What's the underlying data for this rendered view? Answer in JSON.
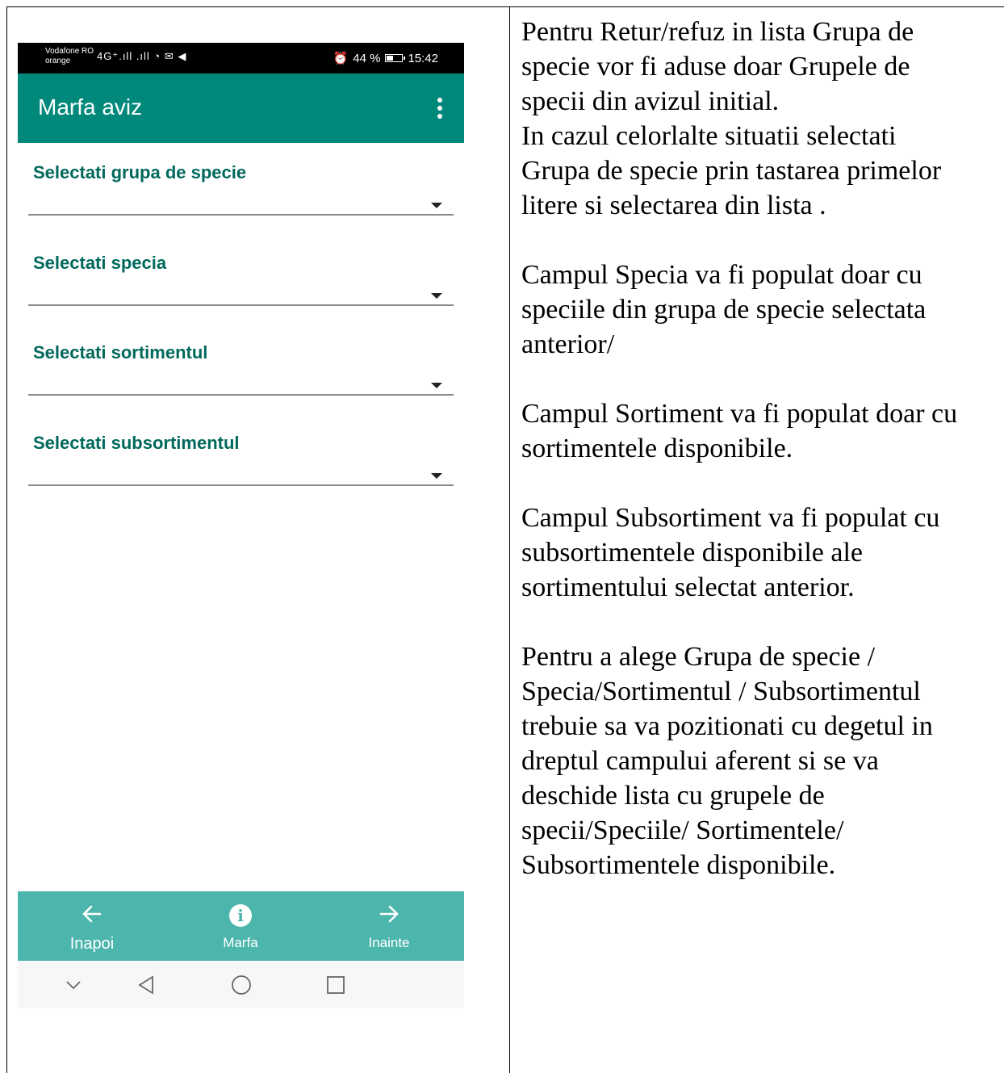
{
  "status_bar": {
    "carrier_line1": "Vodafone RO",
    "carrier_line2": "orange",
    "network_icons": "4G⁺.ıll .ıll ◔ ✉ ◀",
    "battery_text": "44 %",
    "battery_level_percent": 44,
    "time": "15:42"
  },
  "app_bar": {
    "title": "Marfa aviz",
    "menu_icon": "more-vert-icon"
  },
  "fields": [
    {
      "label": "Selectati grupa de specie"
    },
    {
      "label": "Selectati specia"
    },
    {
      "label": "Selectati sortimentul"
    },
    {
      "label": "Selectati subsortimentul"
    }
  ],
  "bottom_nav": {
    "back": {
      "label": "Inapoi",
      "icon": "arrow-left-icon"
    },
    "info": {
      "label": "Marfa",
      "icon": "info-icon"
    },
    "next": {
      "label": "Inainte",
      "icon": "arrow-right-icon"
    }
  },
  "system_nav": [
    "chevron-down-icon",
    "back-triangle-icon",
    "home-circle-icon",
    "recents-square-icon"
  ],
  "instructions": [
    {
      "lines": [
        "Pentru Retur/refuz in lista Grupa de",
        "specie vor fi aduse doar Grupele de",
        "specii din avizul initial.",
        "In cazul celorlalte situatii selectati",
        "Grupa de specie prin tastarea primelor",
        "litere si selectarea din lista ."
      ]
    },
    {
      "lines": [
        "Campul Specia va fi populat doar cu",
        "speciile din grupa de specie selectata",
        "anterior/"
      ]
    },
    {
      "lines": [
        "Campul Sortiment va fi populat doar cu",
        "sortimentele disponibile."
      ]
    },
    {
      "lines": [
        "Campul Subsortiment va fi populat cu",
        "subsortimentele disponibile ale",
        "sortimentului selectat anterior."
      ]
    },
    {
      "lines": [
        "Pentru a alege Grupa de specie /",
        "Specia/Sortimentul / Subsortimentul",
        "trebuie sa va pozitionati  cu degetul in",
        "dreptul campului aferent si se va",
        "deschide lista cu grupele de",
        "specii/Speciile/ Sortimentele/",
        "Subsortimentele disponibile."
      ]
    }
  ]
}
